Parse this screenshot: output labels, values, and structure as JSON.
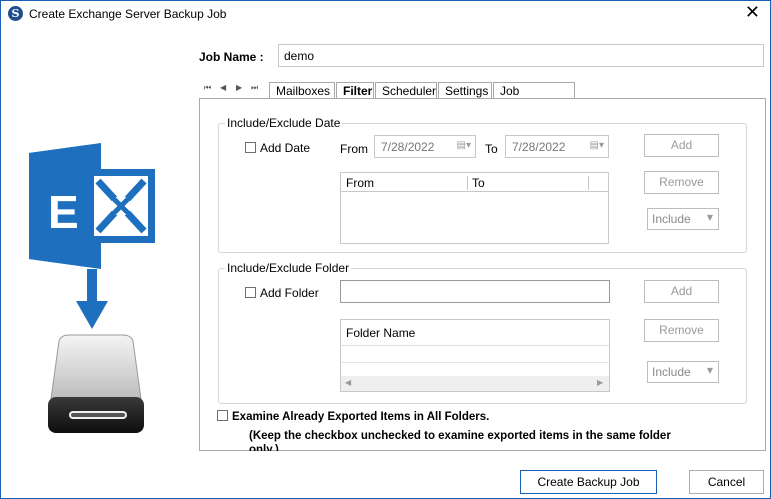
{
  "window": {
    "title": "Create Exchange Server Backup Job",
    "app_icon_letter": "S",
    "close_glyph": "✕"
  },
  "illustration": {
    "logo_letter": "E",
    "exchange_blue": "#1e6fbd",
    "arrow_blue": "#1e6fbd"
  },
  "job": {
    "label": "Job Name :",
    "value": "demo"
  },
  "tabs": {
    "nav": [
      "⏮",
      "◀",
      "▶",
      "⏭"
    ],
    "items": [
      {
        "label": "Mailboxes",
        "active": false
      },
      {
        "label": "Filter",
        "active": true
      },
      {
        "label": "Scheduler",
        "active": false
      },
      {
        "label": "Settings",
        "active": false
      },
      {
        "label": "Job Directory",
        "active": false
      }
    ]
  },
  "date_group": {
    "title": "Include/Exclude Date",
    "checkbox_label": "Add Date",
    "from_label": "From",
    "to_label": "To",
    "from_value": "7/28/2022",
    "to_value": "7/28/2022",
    "grid_columns": [
      "From",
      "To"
    ],
    "add_label": "Add",
    "remove_label": "Remove",
    "mode_value": "Include"
  },
  "folder_group": {
    "title": "Include/Exclude Folder",
    "checkbox_label": "Add Folder",
    "folder_value": "",
    "grid_columns": [
      "Folder Name"
    ],
    "add_label": "Add",
    "remove_label": "Remove",
    "mode_value": "Include"
  },
  "footer": {
    "examine_label": "Examine Already Exported Items in All Folders.",
    "note": "(Keep the checkbox unchecked to examine exported items in the same folder only.)",
    "create_label": "Create Backup Job",
    "cancel_label": "Cancel"
  },
  "colors": {
    "accent": "#1a5fb4",
    "disabled_text": "#9b9b9b"
  }
}
